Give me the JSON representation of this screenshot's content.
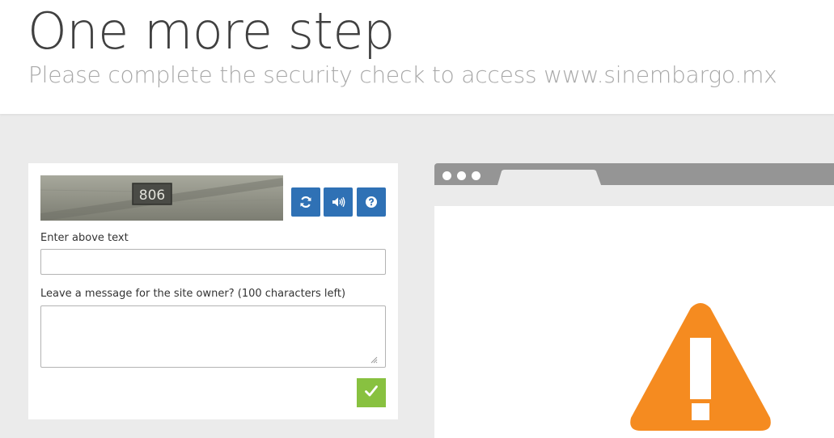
{
  "header": {
    "title": "One more step",
    "subtitle": "Please complete the security check to access www.sinembargo.mx"
  },
  "captcha": {
    "image_text": "806",
    "refresh_icon": "refresh-icon",
    "audio_icon": "audio-icon",
    "help_icon": "help-icon",
    "enter_label": "Enter above text",
    "message_label": "Leave a message for the site owner? (100 characters left)",
    "text_value": "",
    "message_value": "",
    "submit_icon": "checkmark-icon"
  },
  "colors": {
    "button_blue": "#2f71b5",
    "submit_green": "#88c140",
    "warning_orange": "#f58b20",
    "browser_bar_gray": "#959595"
  },
  "illustration": {
    "icon": "warning-icon"
  }
}
